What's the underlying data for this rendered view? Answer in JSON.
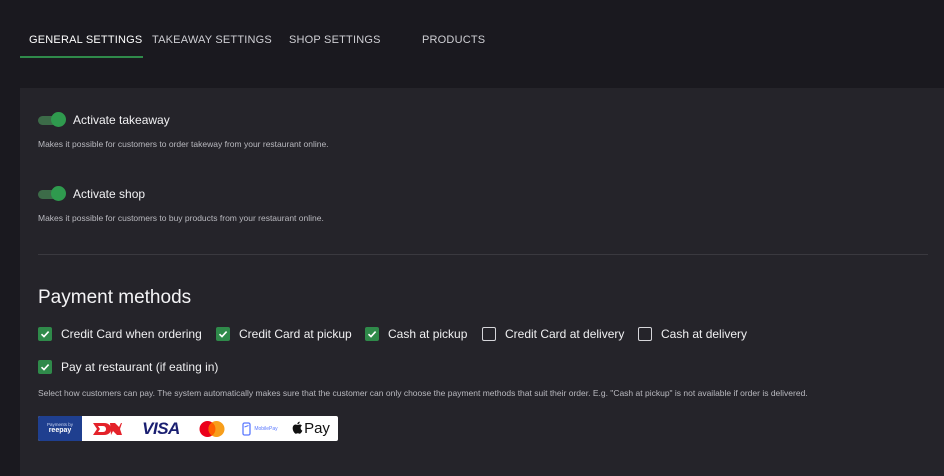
{
  "tabs": [
    {
      "label": "GENERAL SETTINGS",
      "active": true
    },
    {
      "label": "TAKEAWAY SETTINGS",
      "active": false
    },
    {
      "label": "SHOP SETTINGS",
      "active": false
    },
    {
      "label": "PRODUCTS",
      "active": false
    }
  ],
  "toggles": {
    "takeaway": {
      "label": "Activate takeaway",
      "enabled": true,
      "help": "Makes it possible for customers to order takeway from your restaurant online."
    },
    "shop": {
      "label": "Activate shop",
      "enabled": true,
      "help": "Makes it possible for customers to buy products from your restaurant online."
    }
  },
  "payment": {
    "title": "Payment methods",
    "methods": [
      {
        "label": "Credit Card when ordering",
        "checked": true
      },
      {
        "label": "Credit Card at pickup",
        "checked": true
      },
      {
        "label": "Cash at pickup",
        "checked": true
      },
      {
        "label": "Credit Card at delivery",
        "checked": false
      },
      {
        "label": "Cash at delivery",
        "checked": false
      },
      {
        "label": "Pay at restaurant (if eating in)",
        "checked": true
      }
    ],
    "help": "Select how customers can pay. The system automatically makes sure that the customer can only choose the payment methods that suit their order. E.g. \"Cash at pickup\" is not available if order is delivered.",
    "logos": {
      "reepay_small": "Payments by",
      "reepay": "reepay",
      "visa": "VISA",
      "mobilepay": "MobilePay",
      "applepay": "Pay"
    }
  },
  "colors": {
    "accent": "#2f8a4a",
    "background": "#1a191f",
    "panel": "#25242a"
  }
}
